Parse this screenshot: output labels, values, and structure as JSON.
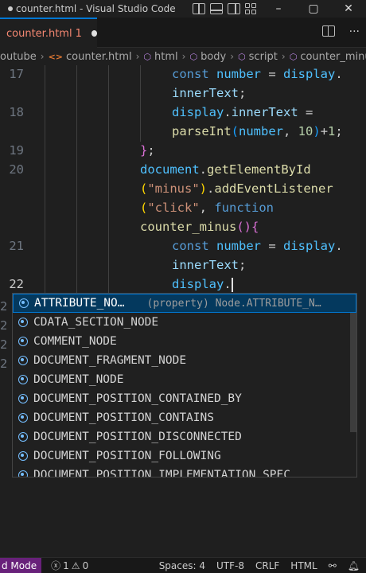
{
  "window": {
    "title": "counter.html - Visual Studio Code",
    "controls": [
      "–",
      "▢",
      "✕"
    ]
  },
  "tab": {
    "filename": "counter.html",
    "problems": "1"
  },
  "breadcrumb": [
    "outube",
    "counter.html",
    "html",
    "body",
    "script",
    "counter_minus"
  ],
  "editor": {
    "lines": [
      {
        "num": "17",
        "parts": [
          [
            "kw",
            "const"
          ],
          [
            "",
            " "
          ],
          [
            "var",
            "number"
          ],
          [
            "",
            " = "
          ],
          [
            "var",
            "display"
          ],
          [
            "",
            "."
          ]
        ]
      },
      {
        "num": "",
        "parts": [
          [
            "prop",
            "innerText"
          ],
          [
            "",
            ";"
          ]
        ]
      },
      {
        "num": "18",
        "parts": [
          [
            "var",
            "display"
          ],
          [
            "",
            "."
          ],
          [
            "prop",
            "innerText"
          ],
          [
            "",
            " ="
          ]
        ]
      },
      {
        "num": "",
        "parts": [
          [
            "fn",
            "parseInt"
          ],
          [
            "brk3",
            "("
          ],
          [
            "var",
            "number"
          ],
          [
            "",
            ", "
          ],
          [
            "num",
            "10"
          ],
          [
            "brk3",
            ")"
          ],
          [
            "",
            "+"
          ],
          [
            "num",
            "1"
          ],
          [
            "",
            ";"
          ]
        ]
      },
      {
        "num": "19",
        "parts": [
          [
            "brk2",
            "}"
          ],
          [
            "",
            ";"
          ]
        ]
      },
      {
        "num": "20",
        "parts": [
          [
            "var",
            "document"
          ],
          [
            "",
            "."
          ],
          [
            "fn",
            "getElementById"
          ]
        ]
      },
      {
        "num": "",
        "parts": [
          [
            "brk1",
            "("
          ],
          [
            "str",
            "\"minus\""
          ],
          [
            "brk1",
            ")"
          ],
          [
            "",
            "."
          ],
          [
            "fn",
            "addEventListener"
          ]
        ]
      },
      {
        "num": "",
        "parts": [
          [
            "brk1",
            "("
          ],
          [
            "str",
            "\"click\""
          ],
          [
            "",
            ", "
          ],
          [
            "kw",
            "function"
          ]
        ]
      },
      {
        "num": "",
        "parts": [
          [
            "fn",
            "counter_minus"
          ],
          [
            "brk2",
            "()"
          ],
          [
            "brk2",
            "{"
          ]
        ]
      },
      {
        "num": "21",
        "parts": [
          [
            "kw",
            "const"
          ],
          [
            "",
            " "
          ],
          [
            "var",
            "number"
          ],
          [
            "",
            " = "
          ],
          [
            "var",
            "display"
          ],
          [
            "",
            "."
          ]
        ]
      },
      {
        "num": "",
        "parts": [
          [
            "prop",
            "innerText"
          ],
          [
            "",
            ";"
          ]
        ]
      },
      {
        "num": "22",
        "parts": [
          [
            "var",
            "display"
          ],
          [
            "",
            "."
          ]
        ]
      }
    ]
  },
  "suggest": {
    "items": [
      {
        "label": "ATTRIBUTE_NO…",
        "detail_type": "(property)",
        "detail": "Node.ATTRIBUTE_N…",
        "selected": true
      },
      {
        "label": "CDATA_SECTION_NODE"
      },
      {
        "label": "COMMENT_NODE"
      },
      {
        "label": "DOCUMENT_FRAGMENT_NODE"
      },
      {
        "label": "DOCUMENT_NODE"
      },
      {
        "label": "DOCUMENT_POSITION_CONTAINED_BY"
      },
      {
        "label": "DOCUMENT_POSITION_CONTAINS"
      },
      {
        "label": "DOCUMENT_POSITION_DISCONNECTED"
      },
      {
        "label": "DOCUMENT_POSITION_FOLLOWING"
      },
      {
        "label": "DOCUMENT_POSITION_IMPLEMENTATION_SPEC"
      }
    ]
  },
  "statusbar": {
    "mode": "d Mode",
    "errors": "1",
    "warnings": "0",
    "spaces": "Spaces: 4",
    "encoding": "UTF-8",
    "eol": "CRLF",
    "language": "HTML"
  },
  "colors": {
    "accent": "#0078d4",
    "mode_bg": "#68217a",
    "modified_tab": "#f48771"
  }
}
